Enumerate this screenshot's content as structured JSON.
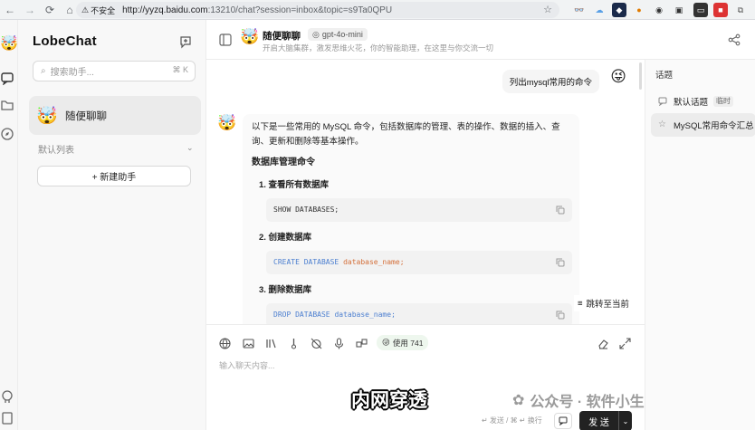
{
  "browser": {
    "security_label": "不安全",
    "url_host": "http://yyzq.baidu.com",
    "url_rest": ":13210/chat?session=inbox&topic=s9Ta0QPU"
  },
  "sidebar": {
    "brand": "LobeChat",
    "search_placeholder": "搜索助手...",
    "search_shortcut": "⌘ K",
    "active_agent": {
      "emoji": "🤯",
      "name": "随便聊聊"
    },
    "group_title": "默认列表",
    "new_agent_label": "+ 新建助手"
  },
  "header": {
    "emoji": "🤯",
    "title": "随便聊聊",
    "model": "gpt-4o-mini",
    "description": "开启大脑集群，激发思维火花，你的智能助理，在这里与你交流一切"
  },
  "chat": {
    "user_message": "列出mysql常用的命令",
    "user_avatar": "😜",
    "ai_avatar": "🤯",
    "ai_intro": "以下是一些常用的 MySQL 命令，包括数据库的管理、表的操作、数据的插入、查询、更新和删除等基本操作。",
    "section_title": "数据库管理命令",
    "items": [
      {
        "label": "1. 查看所有数据库",
        "code_kw": "SHOW DATABASES;",
        "code_arg": ""
      },
      {
        "label": "2. 创建数据库",
        "code_kw": "CREATE DATABASE",
        "code_arg": "database_name;"
      },
      {
        "label": "3. 删除数据库",
        "code_kw": "DROP DATABASE",
        "code_arg": "database_name;"
      }
    ],
    "jump_label": "跳转至当前"
  },
  "input": {
    "usage_label": "使用 741",
    "placeholder": "输入聊天内容...",
    "hint": "↵ 发送 / ⌘ ↵ 换行",
    "send_label": "发 送",
    "subtitle_overlay": "内网穿透",
    "watermark": "公众号 · 软件小生活"
  },
  "topics": {
    "title": "话题",
    "items": [
      {
        "label": "默认话题",
        "tag": "临时"
      },
      {
        "label": "MySQL常用命令汇总",
        "tag": ""
      }
    ]
  },
  "colors": {
    "accent": "#222222",
    "code_keyword": "#4c7fd0",
    "code_arg": "#d4703b"
  }
}
